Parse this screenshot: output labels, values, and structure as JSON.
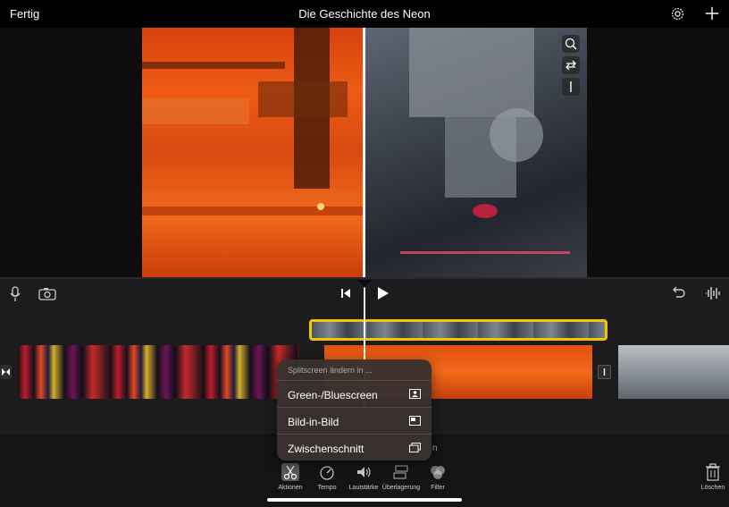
{
  "header": {
    "done_label": "Fertig",
    "title": "Die Geschichte des Neon",
    "settings_icon": "gear-icon",
    "add_icon": "plus-icon"
  },
  "viewer": {
    "tools": [
      "zoom-icon",
      "swap-icon",
      "split-line-icon"
    ]
  },
  "controls": {
    "icons": [
      "microphone-icon",
      "camera-icon",
      "skip-back-icon",
      "play-icon",
      "undo-icon",
      "waveform-icon"
    ]
  },
  "popover": {
    "heading": "Splitscreen ändern in ...",
    "items": [
      {
        "label": "Green-/Bluescreen",
        "icon": "person-frame-icon"
      },
      {
        "label": "Bild-in-Bild",
        "icon": "picture-in-picture-icon"
      },
      {
        "label": "Zwischenschnitt",
        "icon": "cutaway-icon"
      }
    ],
    "partial_text": "n"
  },
  "toolbar": {
    "items": [
      {
        "label": "Aktionen",
        "icon": "scissors-icon",
        "active": true
      },
      {
        "label": "Tempo",
        "icon": "speedometer-icon",
        "active": false
      },
      {
        "label": "Lautstärke",
        "icon": "speaker-icon",
        "active": false
      },
      {
        "label": "Überlagerung",
        "icon": "overlay-icon",
        "active": false
      },
      {
        "label": "Filter",
        "icon": "filter-icon",
        "active": false
      }
    ],
    "delete_label": "Löschen"
  },
  "colors": {
    "accent_yellow": "#f5c400",
    "background": "#1c1c1e"
  }
}
